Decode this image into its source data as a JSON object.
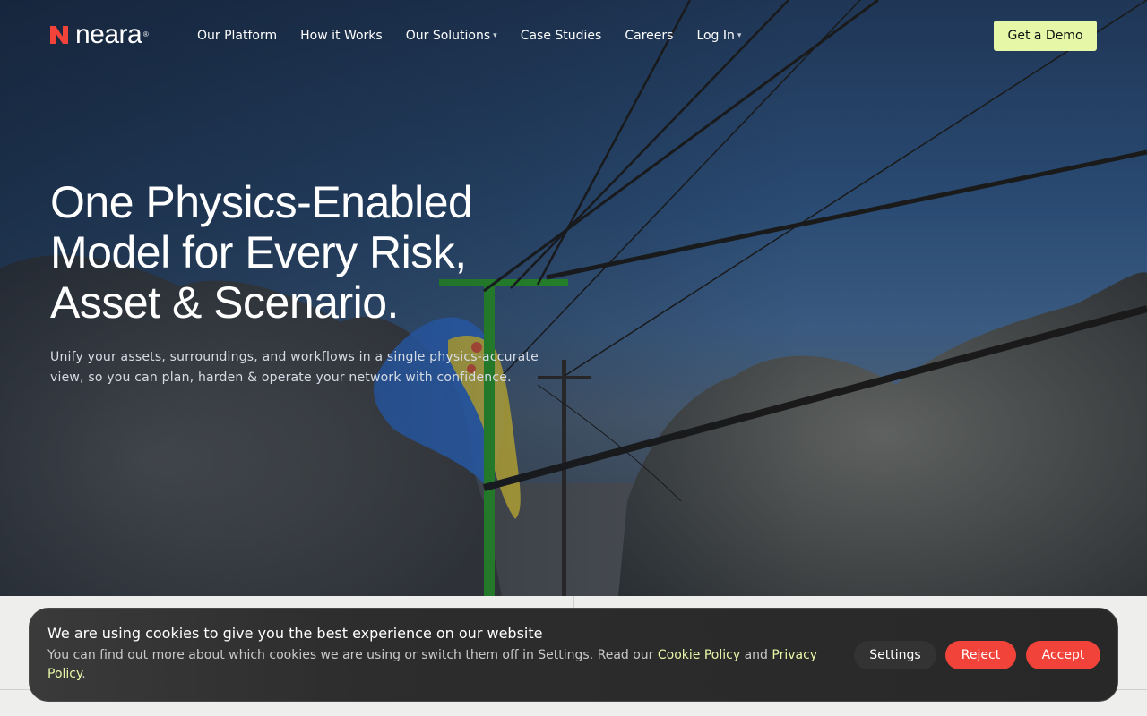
{
  "brand": {
    "name": "neara",
    "mark": "®",
    "accent": "#f2433a"
  },
  "nav": {
    "items": [
      {
        "label": "Our Platform",
        "dropdown": false
      },
      {
        "label": "How it Works",
        "dropdown": false
      },
      {
        "label": "Our Solutions",
        "dropdown": true
      },
      {
        "label": "Case Studies",
        "dropdown": false
      },
      {
        "label": "Careers",
        "dropdown": false
      },
      {
        "label": "Log In",
        "dropdown": true
      }
    ],
    "dropdown_glyph": "▾",
    "cta_label": "Get a Demo",
    "cta_color": "#e6f8a8"
  },
  "hero": {
    "headline_line1": "One Physics-Enabled",
    "headline_line2": "Model for Every Risk,",
    "headline_line3": "Asset & Scenario.",
    "subtext": "Unify your assets, surroundings, and workflows in a single physics-accurate view, so you can plan, harden & operate your network with confidence."
  },
  "cookie_banner": {
    "title": "We are using cookies to give you the best experience on our website",
    "text_before": "You can find out more about which cookies we are using or switch them off in Settings. Read our ",
    "cookie_policy_link": "Cookie Policy",
    "text_between": " and ",
    "privacy_policy_link": "Privacy Policy",
    "text_after": ".",
    "settings_label": "Settings",
    "reject_label": "Reject",
    "accept_label": "Accept",
    "button_color": "#f2433a"
  }
}
